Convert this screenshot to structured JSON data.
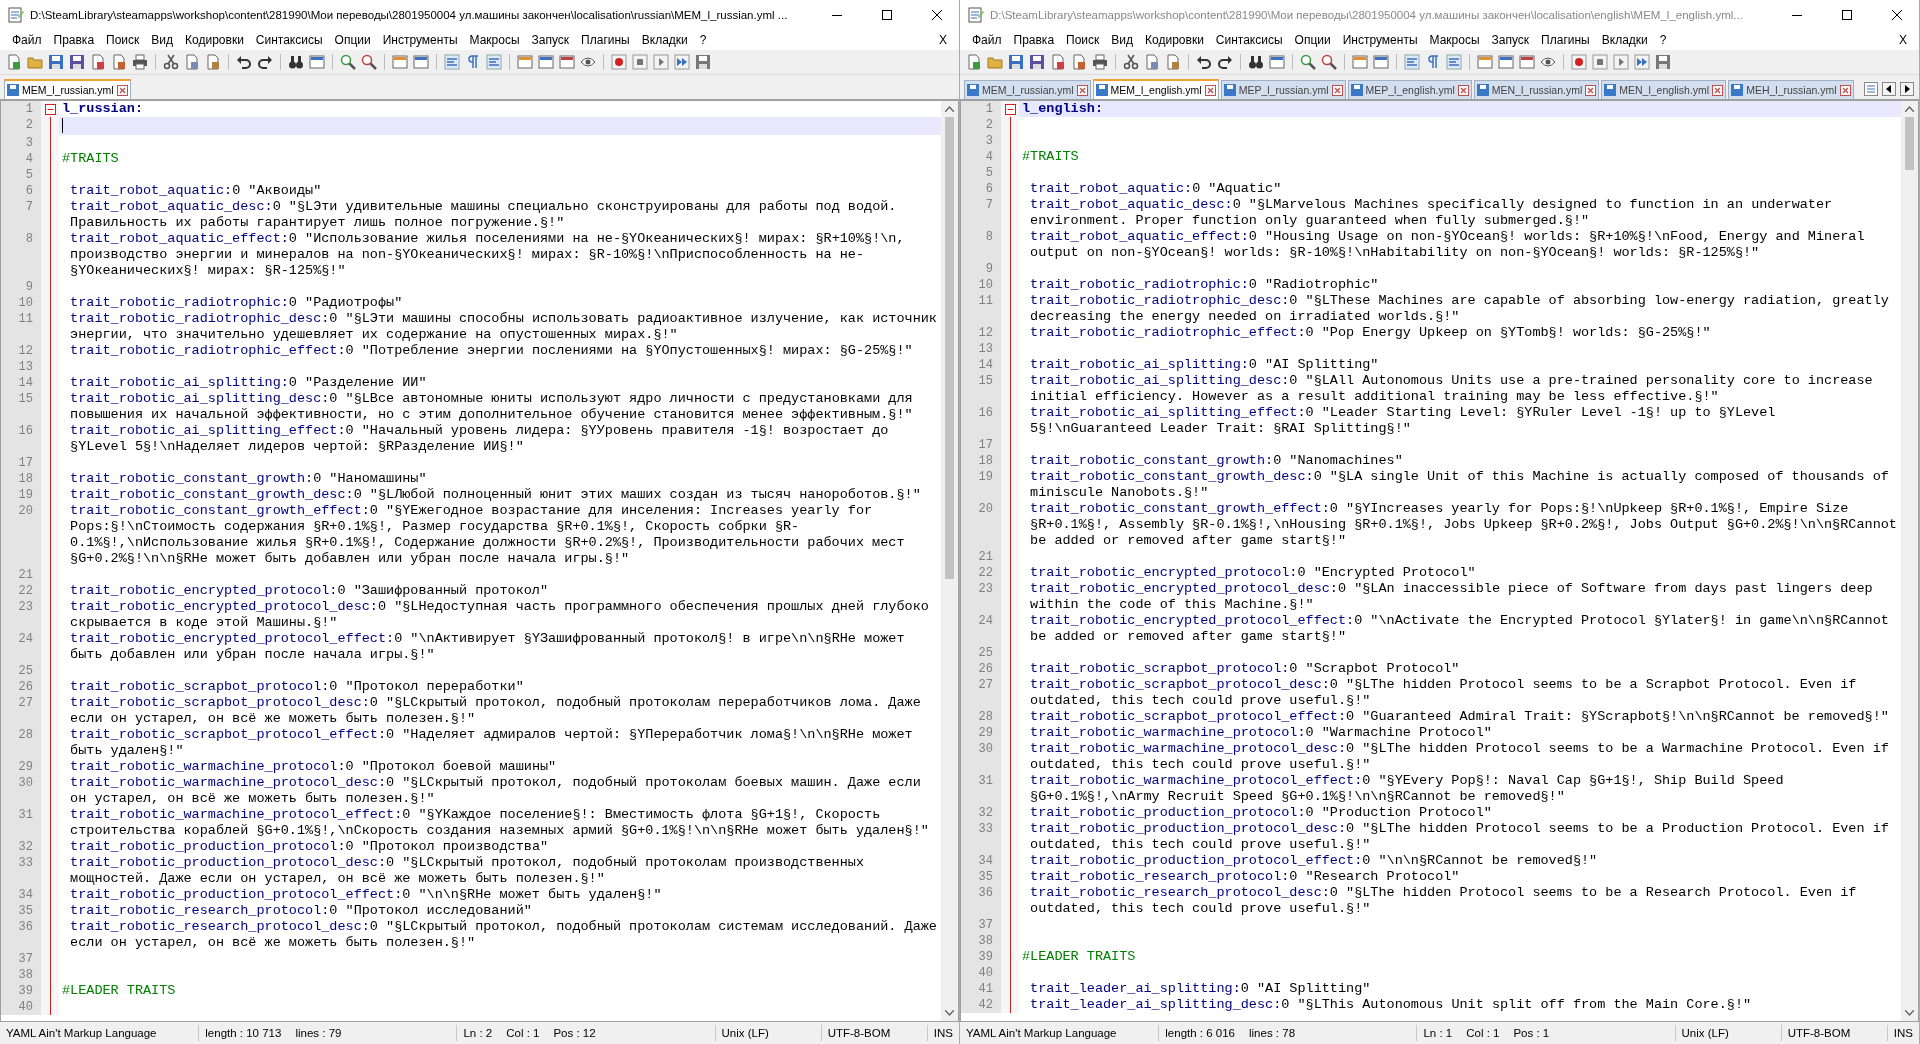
{
  "windows": [
    {
      "title": "D:\\SteamLibrary\\steamapps\\workshop\\content\\281990\\Мои переводы\\2801950004 ул.машины закончен\\localisation\\russian\\MEM_l_russian.yml ...",
      "active": true,
      "menu": [
        "Файл",
        "Правка",
        "Поиск",
        "Вид",
        "Кодировки",
        "Синтаксисы",
        "Опции",
        "Инструменты",
        "Макросы",
        "Запуск",
        "Плагины",
        "Вкладки",
        "?"
      ],
      "close_doc": "X",
      "tabs": [
        {
          "label": "MEM_l_russian.yml",
          "selected": true
        }
      ],
      "lines": [
        {
          "n": "1",
          "kind": "header",
          "text": "l_russian:",
          "expanded": true,
          "current": false
        },
        {
          "n": "2",
          "kind": "blank",
          "current": true
        },
        {
          "n": "3",
          "kind": "blank",
          "current": false
        },
        {
          "n": "4",
          "kind": "comment",
          "text": "#TRAITS",
          "current": false
        },
        {
          "n": "5",
          "kind": "blank",
          "current": false
        },
        {
          "n": "6",
          "kind": "entry",
          "key": "trait_robot_aquatic:",
          "value": "0 \"Аквоиды\"",
          "current": false
        },
        {
          "n": "7",
          "kind": "entry",
          "key": "trait_robot_aquatic_desc:",
          "value": "0 \"§LЭти удивительные машины специально сконструированы для работы под водой. Правильность их работы гарантирует лишь полное погружение.§!\"",
          "current": false
        },
        {
          "n": "8",
          "kind": "entry",
          "key": "trait_robot_aquatic_effect:",
          "value": "0 \"Использование жилья поселениями на не-§YОкеанических§! мирах: §R+10%§!\\n, производство энергии и минералов на non-§YОкеанических§! мирах: §R-10%§!\\nПриспособленность на не-§YОкеанических§! мирах: §R-125%§!\"",
          "current": false
        },
        {
          "n": "9",
          "kind": "blank",
          "current": false
        },
        {
          "n": "10",
          "kind": "entry",
          "key": "trait_robotic_radiotrophic:",
          "value": "0 \"Радиотрофы\"",
          "current": false
        },
        {
          "n": "11",
          "kind": "entry",
          "key": "trait_robotic_radiotrophic_desc:",
          "value": "0 \"§LЭти машины способны использовать радиоактивное излучение, как источник энергии, что значительно удешевляет их содержание на опустошенных мирах.§!\"",
          "current": false
        },
        {
          "n": "12",
          "kind": "entry",
          "key": "trait_robotic_radiotrophic_effect:",
          "value": "0 \"Потребление энергии послениями на §YОпустошенных§! мирах: §G-25%§!\"",
          "current": false
        },
        {
          "n": "13",
          "kind": "blank",
          "current": false
        },
        {
          "n": "14",
          "kind": "entry",
          "key": "trait_robotic_ai_splitting:",
          "value": "0 \"Разделение ИИ\"",
          "current": false
        },
        {
          "n": "15",
          "kind": "entry",
          "key": "trait_robotic_ai_splitting_desc:",
          "value": "0 \"§LВсе автономные юниты используют ядро личности с предустановками для повышения их начальной эффективности, но с этим дополнительное обучение становится менее эффективным.§!\"",
          "current": false
        },
        {
          "n": "16",
          "kind": "entry",
          "key": "trait_robotic_ai_splitting_effect:",
          "value": "0 \"Начальный уровень лидера: §YУровень правителя -1§! возростает до §YLevel 5§!\\nНаделяет лидеров чертой: §RРазделение ИИ§!\"",
          "current": false
        },
        {
          "n": "17",
          "kind": "blank",
          "current": false
        },
        {
          "n": "18",
          "kind": "entry",
          "key": "trait_robotic_constant_growth:",
          "value": "0 \"Наномашины\"",
          "current": false
        },
        {
          "n": "19",
          "kind": "entry",
          "key": "trait_robotic_constant_growth_desc:",
          "value": "0 \"§LЛюбой полноценный юнит этих маших создан из тысяч нанороботов.§!\"",
          "current": false
        },
        {
          "n": "20",
          "kind": "entry",
          "key": "trait_robotic_constant_growth_effect:",
          "value": "0 \"§YЕжегодное возрастание для инселения: Increases yearly for Pops:§!\\nСтоимость содержания §R+0.1%§!, Размер государства §R+0.1%§!, Скорость собрки §R-0.1%§!,\\nИспользование жилья §R+0.1%§!, Содержание должности §R+0.2%§!, Производительности рабочих мест §G+0.2%§!\\n\\n§RНе может быть добавлен или убран после начала игры.§!\"",
          "current": false
        },
        {
          "n": "21",
          "kind": "blank",
          "current": false
        },
        {
          "n": "22",
          "kind": "entry",
          "key": "trait_robotic_encrypted_protocol:",
          "value": "0 \"Зашифрованный протокол\"",
          "current": false
        },
        {
          "n": "23",
          "kind": "entry",
          "key": "trait_robotic_encrypted_protocol_desc:",
          "value": "0 \"§LНедоступная часть программного обеспечения прошлых дней глубоко скрывается в коде этой Машины.§!\"",
          "current": false
        },
        {
          "n": "24",
          "kind": "entry",
          "key": "trait_robotic_encrypted_protocol_effect:",
          "value": "0 \"\\nАктивирует §YЗашифрованный протокол§! в игре\\n\\n§RНе может быть добавлен или убран после начала игры.§!\"",
          "current": false
        },
        {
          "n": "25",
          "kind": "blank",
          "current": false
        },
        {
          "n": "26",
          "kind": "entry",
          "key": "trait_robotic_scrapbot_protocol:",
          "value": "0 \"Протокол переработки\"",
          "current": false
        },
        {
          "n": "27",
          "kind": "entry",
          "key": "trait_robotic_scrapbot_protocol_desc:",
          "value": "0 \"§LСкрытый протокол, подобный протоколам переработчиков лома. Даже если он устарел, он всё же можеть быть полезен.§!\"",
          "current": false
        },
        {
          "n": "28",
          "kind": "entry",
          "key": "trait_robotic_scrapbot_protocol_effect:",
          "value": "0 \"Наделяет адмиралов чертой: §YПереработчик лома§!\\n\\n§RНе может быть удален§!\"",
          "current": false
        },
        {
          "n": "29",
          "kind": "entry",
          "key": "trait_robotic_warmachine_protocol:",
          "value": "0 \"Протокол боевой машины\"",
          "current": false
        },
        {
          "n": "30",
          "kind": "entry",
          "key": "trait_robotic_warmachine_protocol_desc:",
          "value": "0 \"§LСкрытый протокол, подобный протоколам боевых машин. Даже если он устарел, он всё же можеть быть полезен.§!\"",
          "current": false
        },
        {
          "n": "31",
          "kind": "entry",
          "key": "trait_robotic_warmachine_protocol_effect:",
          "value": "0 \"§YКаждое поселение§!: Вместимость флота §G+1§!, Скорость строительства кораблей §G+0.1%§!,\\nСкорость создания наземных армий §G+0.1%§!\\n\\n§RНе может быть удален§!\"",
          "current": false
        },
        {
          "n": "32",
          "kind": "entry",
          "key": "trait_robotic_production_protocol:",
          "value": "0 \"Протокол производства\"",
          "current": false
        },
        {
          "n": "33",
          "kind": "entry",
          "key": "trait_robotic_production_protocol_desc:",
          "value": "0 \"§LСкрытый протокол, подобный протоколам производственных мощностей. Даже если он устарел, он всё же можеть быть полезен.§!\"",
          "current": false
        },
        {
          "n": "34",
          "kind": "entry",
          "key": "trait_robotic_production_protocol_effect:",
          "value": "0 \"\\n\\n§RНе может быть удален§!\"",
          "current": false
        },
        {
          "n": "35",
          "kind": "entry",
          "key": "trait_robotic_research_protocol:",
          "value": "0 \"Протокол исследований\"",
          "current": false
        },
        {
          "n": "36",
          "kind": "entry",
          "key": "trait_robotic_research_protocol_desc:",
          "value": "0 \"§LСкрытый протокол, подобный протоколам системам исследований. Даже если он устарел, он всё же можеть быть полезен.§!\"",
          "current": false
        },
        {
          "n": "37",
          "kind": "blank",
          "current": false
        },
        {
          "n": "38",
          "kind": "blank",
          "current": false
        },
        {
          "n": "39",
          "kind": "comment",
          "text": "#LEADER TRAITS",
          "current": false
        },
        {
          "n": "40",
          "kind": "blank",
          "current": false
        }
      ],
      "status": {
        "language": "YAML Ain't Markup Language",
        "length": "length : 10 713",
        "lines": "lines : 79",
        "line": "Ln : 2",
        "column": "Col : 1",
        "position": "Pos : 12",
        "eol": "Unix (LF)",
        "encoding": "UTF-8-BOM",
        "mode": "INS"
      }
    },
    {
      "title": "D:\\SteamLibrary\\steamapps\\workshop\\content\\281990\\Мои переводы\\2801950004 ул.машины закончен\\localisation\\english\\MEM_l_english.yml...",
      "active": false,
      "menu": [
        "Файл",
        "Правка",
        "Поиск",
        "Вид",
        "Кодировки",
        "Синтаксисы",
        "Опции",
        "Инструменты",
        "Макросы",
        "Запуск",
        "Плагины",
        "Вкладки",
        "?"
      ],
      "close_doc": "X",
      "tabs": [
        {
          "label": "MEM_l_russian.yml",
          "selected": false
        },
        {
          "label": "MEM_l_english.yml",
          "selected": true
        },
        {
          "label": "MEP_l_russian.yml",
          "selected": false
        },
        {
          "label": "MEP_l_english.yml",
          "selected": false
        },
        {
          "label": "MEN_l_russian.yml",
          "selected": false
        },
        {
          "label": "MEN_l_english.yml",
          "selected": false
        },
        {
          "label": "MEH_l_russian.yml",
          "selected": false
        }
      ],
      "lines": [
        {
          "n": "1",
          "kind": "header",
          "text": "l_english:",
          "expanded": true,
          "current": true
        },
        {
          "n": "2",
          "kind": "blank",
          "current": false
        },
        {
          "n": "3",
          "kind": "blank",
          "current": false
        },
        {
          "n": "4",
          "kind": "comment",
          "text": "#TRAITS",
          "current": false
        },
        {
          "n": "5",
          "kind": "blank",
          "current": false
        },
        {
          "n": "6",
          "kind": "entry",
          "key": "trait_robot_aquatic:",
          "value": "0 \"Aquatic\"",
          "current": false
        },
        {
          "n": "7",
          "kind": "entry",
          "key": "trait_robot_aquatic_desc:",
          "value": "0 \"§LMarvelous Machines specifically designed to function in an underwater environment. Proper function only guaranteed when fully submerged.§!\"",
          "current": false
        },
        {
          "n": "8",
          "kind": "entry",
          "key": "trait_robot_aquatic_effect:",
          "value": "0 \"Housing Usage on non-§YOcean§! worlds: §R+10%§!\\nFood, Energy and Mineral output on non-§YOcean§! worlds: §R-10%§!\\nHabitability on non-§YOcean§! worlds: §R-125%§!\"",
          "current": false
        },
        {
          "n": "9",
          "kind": "blank",
          "current": false
        },
        {
          "n": "10",
          "kind": "entry",
          "key": "trait_robotic_radiotrophic:",
          "value": "0 \"Radiotrophic\"",
          "current": false
        },
        {
          "n": "11",
          "kind": "entry",
          "key": "trait_robotic_radiotrophic_desc:",
          "value": "0 \"§LThese Machines are capable of absorbing low-energy radiation, greatly decreasing the energy needed on irradiated worlds.§!\"",
          "current": false
        },
        {
          "n": "12",
          "kind": "entry",
          "key": "trait_robotic_radiotrophic_effect:",
          "value": "0 \"Pop Energy Upkeep on §YTomb§! worlds: §G-25%§!\"",
          "current": false
        },
        {
          "n": "13",
          "kind": "blank",
          "current": false
        },
        {
          "n": "14",
          "kind": "entry",
          "key": "trait_robotic_ai_splitting:",
          "value": "0 \"AI Splitting\"",
          "current": false
        },
        {
          "n": "15",
          "kind": "entry",
          "key": "trait_robotic_ai_splitting_desc:",
          "value": "0 \"§LAll Autonomous Units use a pre-trained personality core to increase initial efficiency. However as a result additional training may be less effective.§!\"",
          "current": false
        },
        {
          "n": "16",
          "kind": "entry",
          "key": "trait_robotic_ai_splitting_effect:",
          "value": "0 \"Leader Starting Level: §YRuler Level -1§! up to §YLevel 5§!\\nGuaranteed Leader Trait: §RAI Splitting§!\"",
          "current": false
        },
        {
          "n": "17",
          "kind": "blank",
          "current": false
        },
        {
          "n": "18",
          "kind": "entry",
          "key": "trait_robotic_constant_growth:",
          "value": "0 \"Nanomachines\"",
          "current": false
        },
        {
          "n": "19",
          "kind": "entry",
          "key": "trait_robotic_constant_growth_desc:",
          "value": "0 \"§LA single Unit of this Machine is actually composed of thousands of miniscule Nanobots.§!\"",
          "current": false
        },
        {
          "n": "20",
          "kind": "entry",
          "key": "trait_robotic_constant_growth_effect:",
          "value": "0 \"§YIncreases yearly for Pops:§!\\nUpkeep §R+0.1%§!, Empire Size §R+0.1%§!, Assembly §R-0.1%§!,\\nHousing §R+0.1%§!, Jobs Upkeep §R+0.2%§!, Jobs Output §G+0.2%§!\\n\\n§RCannot be added or removed after game start§!\"",
          "current": false
        },
        {
          "n": "21",
          "kind": "blank",
          "current": false
        },
        {
          "n": "22",
          "kind": "entry",
          "key": "trait_robotic_encrypted_protocol:",
          "value": "0 \"Encrypted Protocol\"",
          "current": false
        },
        {
          "n": "23",
          "kind": "entry",
          "key": "trait_robotic_encrypted_protocol_desc:",
          "value": "0 \"§LAn inaccessible piece of Software from days past lingers deep within the code of this Machine.§!\"",
          "current": false
        },
        {
          "n": "24",
          "kind": "entry",
          "key": "trait_robotic_encrypted_protocol_effect:",
          "value": "0 \"\\nActivate the Encrypted Protocol §Ylater§! in game\\n\\n§RCannot be added or removed after game start§!\"",
          "current": false
        },
        {
          "n": "25",
          "kind": "blank",
          "current": false
        },
        {
          "n": "26",
          "kind": "entry",
          "key": "trait_robotic_scrapbot_protocol:",
          "value": "0 \"Scrapbot Protocol\"",
          "current": false
        },
        {
          "n": "27",
          "kind": "entry",
          "key": "trait_robotic_scrapbot_protocol_desc:",
          "value": "0 \"§LThe hidden Protocol seems to be a Scrapbot Protocol. Even if outdated, this tech could prove useful.§!\"",
          "current": false
        },
        {
          "n": "28",
          "kind": "entry",
          "key": "trait_robotic_scrapbot_protocol_effect:",
          "value": "0 \"Guaranteed Admiral Trait: §YScrapbot§!\\n\\n§RCannot be removed§!\"",
          "current": false
        },
        {
          "n": "29",
          "kind": "entry",
          "key": "trait_robotic_warmachine_protocol:",
          "value": "0 \"Warmachine Protocol\"",
          "current": false
        },
        {
          "n": "30",
          "kind": "entry",
          "key": "trait_robotic_warmachine_protocol_desc:",
          "value": "0 \"§LThe hidden Protocol seems to be a Warmachine Protocol. Even if outdated, this tech could prove useful.§!\"",
          "current": false
        },
        {
          "n": "31",
          "kind": "entry",
          "key": "trait_robotic_warmachine_protocol_effect:",
          "value": "0 \"§YEvery Pop§!: Naval Cap §G+1§!, Ship Build Speed §G+0.1%§!,\\nArmy Recruit Speed §G+0.1%§!\\n\\n§RCannot be removed§!\"",
          "current": false
        },
        {
          "n": "32",
          "kind": "entry",
          "key": "trait_robotic_production_protocol:",
          "value": "0 \"Production Protocol\"",
          "current": false
        },
        {
          "n": "33",
          "kind": "entry",
          "key": "trait_robotic_production_protocol_desc:",
          "value": "0 \"§LThe hidden Protocol seems to be a Production Protocol. Even if outdated, this tech could prove useful.§!\"",
          "current": false
        },
        {
          "n": "34",
          "kind": "entry",
          "key": "trait_robotic_production_protocol_effect:",
          "value": "0 \"\\n\\n§RCannot be removed§!\"",
          "current": false
        },
        {
          "n": "35",
          "kind": "entry",
          "key": "trait_robotic_research_protocol:",
          "value": "0 \"Research Protocol\"",
          "current": false
        },
        {
          "n": "36",
          "kind": "entry",
          "key": "trait_robotic_research_protocol_desc:",
          "value": "0 \"§LThe hidden Protocol seems to be a Research Protocol. Even if outdated, this tech could prove useful.§!\"",
          "current": false
        },
        {
          "n": "37",
          "kind": "blank",
          "current": false
        },
        {
          "n": "38",
          "kind": "blank",
          "current": false
        },
        {
          "n": "39",
          "kind": "comment",
          "text": "#LEADER TRAITS",
          "current": false
        },
        {
          "n": "40",
          "kind": "blank",
          "current": false
        },
        {
          "n": "41",
          "kind": "entry",
          "key": "trait_leader_ai_splitting:",
          "value": "0 \"AI Splitting\"",
          "current": false
        },
        {
          "n": "42",
          "kind": "entry",
          "key": "trait_leader_ai_splitting_desc:",
          "value": "0 \"§LThis Autonomous Unit split off from the Main Core.§!\"",
          "current": false
        }
      ],
      "status": {
        "language": "YAML Ain't Markup Language",
        "length": "length : 6 016",
        "lines": "lines : 78",
        "line": "Ln : 1",
        "column": "Col : 1",
        "position": "Pos : 1",
        "eol": "Unix (LF)",
        "encoding": "UTF-8-BOM",
        "mode": "INS"
      }
    }
  ]
}
